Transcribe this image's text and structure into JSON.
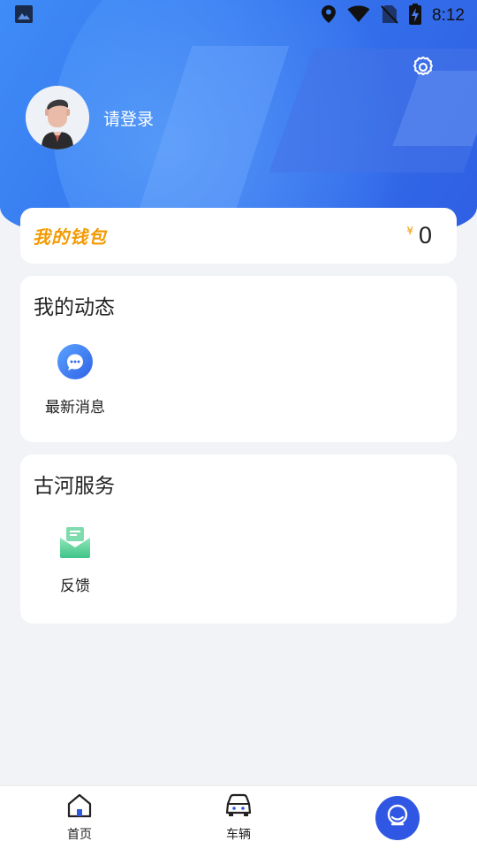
{
  "status_bar": {
    "time": "8:12",
    "icons": [
      "image-icon",
      "location-icon",
      "wifi-icon",
      "no-sim-icon",
      "battery-charging-icon"
    ]
  },
  "header": {
    "login_prompt": "请登录",
    "settings_icon": "gear-icon",
    "avatar_icon": "user-avatar"
  },
  "wallet": {
    "title": "我的钱包",
    "currency": "¥",
    "balance": "0",
    "accent_color": "#f39a00"
  },
  "dynamics": {
    "title": "我的动态",
    "items": [
      {
        "label": "最新消息",
        "icon": "chat-bubble-icon"
      }
    ]
  },
  "services": {
    "title": "古河服务",
    "items": [
      {
        "label": "反馈",
        "icon": "feedback-envelope-icon"
      }
    ]
  },
  "bottom_nav": {
    "items": [
      {
        "label": "首页",
        "icon": "home-icon"
      },
      {
        "label": "车辆",
        "icon": "car-icon"
      },
      {
        "label": "",
        "icon": "customer-service-icon"
      }
    ],
    "active_color": "#2f57e3"
  },
  "colors": {
    "header_gradient_start": "#3f8cf6",
    "header_gradient_end": "#2f5fe3",
    "background": "#f2f3f7"
  }
}
